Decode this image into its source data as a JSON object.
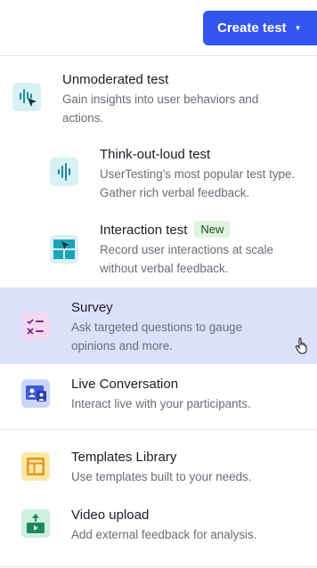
{
  "header": {
    "create_button_label": "Create test"
  },
  "menu": {
    "unmoderated": {
      "title": "Unmoderated test",
      "description": "Gain insights into user behaviors and actions.",
      "icon": "unmoderated-icon"
    },
    "think_out_loud": {
      "title": "Think-out-loud test",
      "description": "UserTesting's most popular test type. Gather rich verbal feedback.",
      "icon": "waveform-icon"
    },
    "interaction": {
      "title": "Interaction test",
      "badge": "New",
      "description": "Record user interactions at scale without verbal feedback.",
      "icon": "interaction-icon"
    },
    "survey": {
      "title": "Survey",
      "description": "Ask targeted questions to gauge opinions and more.",
      "icon": "survey-icon"
    },
    "live_conversation": {
      "title": "Live Conversation",
      "description": "Interact live with your participants.",
      "icon": "live-conversation-icon"
    },
    "templates": {
      "title": "Templates Library",
      "description": "Use templates built to your needs.",
      "icon": "templates-icon"
    },
    "video_upload": {
      "title": "Video upload",
      "description": "Add external feedback for analysis.",
      "icon": "video-upload-icon"
    }
  },
  "colors": {
    "accent": "#3355f0",
    "hover": "#dce1fb",
    "badge_bg": "#dff3dd",
    "badge_text": "#1e4d24"
  }
}
